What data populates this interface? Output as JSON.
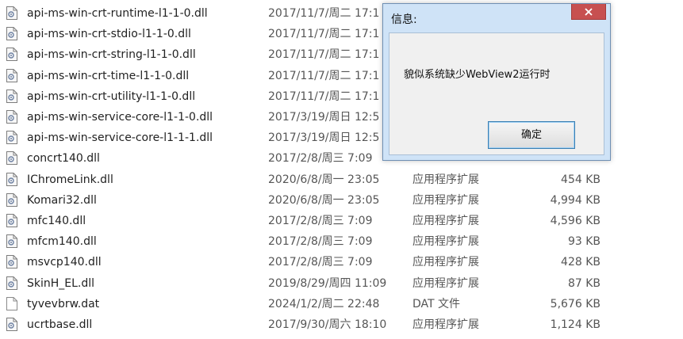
{
  "files": [
    {
      "name": "api-ms-win-crt-runtime-l1-1-0.dll",
      "date": "2017/11/7/周二 17:1",
      "type": "",
      "size": ""
    },
    {
      "name": "api-ms-win-crt-stdio-l1-1-0.dll",
      "date": "2017/11/7/周二 17:1",
      "type": "",
      "size": ""
    },
    {
      "name": "api-ms-win-crt-string-l1-1-0.dll",
      "date": "2017/11/7/周二 17:1",
      "type": "",
      "size": ""
    },
    {
      "name": "api-ms-win-crt-time-l1-1-0.dll",
      "date": "2017/11/7/周二 17:1",
      "type": "",
      "size": ""
    },
    {
      "name": "api-ms-win-crt-utility-l1-1-0.dll",
      "date": "2017/11/7/周二 17:1",
      "type": "",
      "size": ""
    },
    {
      "name": "api-ms-win-service-core-l1-1-0.dll",
      "date": "2017/3/19/周日 12:5",
      "type": "",
      "size": ""
    },
    {
      "name": "api-ms-win-service-core-l1-1-1.dll",
      "date": "2017/3/19/周日 12:5",
      "type": "",
      "size": ""
    },
    {
      "name": "concrt140.dll",
      "date": "2017/2/8/周三 7:09",
      "type": "",
      "size": ""
    },
    {
      "name": "IChromeLink.dll",
      "date": "2020/6/8/周一 23:05",
      "type": "应用程序扩展",
      "size": "454 KB"
    },
    {
      "name": "Komari32.dll",
      "date": "2020/6/8/周一 23:05",
      "type": "应用程序扩展",
      "size": "4,994 KB"
    },
    {
      "name": "mfc140.dll",
      "date": "2017/2/8/周三 7:09",
      "type": "应用程序扩展",
      "size": "4,596 KB"
    },
    {
      "name": "mfcm140.dll",
      "date": "2017/2/8/周三 7:09",
      "type": "应用程序扩展",
      "size": "93 KB"
    },
    {
      "name": "msvcp140.dll",
      "date": "2017/2/8/周三 7:09",
      "type": "应用程序扩展",
      "size": "428 KB"
    },
    {
      "name": "SkinH_EL.dll",
      "date": "2019/8/29/周四 11:09",
      "type": "应用程序扩展",
      "size": "87 KB"
    },
    {
      "name": "tyvevbrw.dat",
      "date": "2024/1/2/周二 22:48",
      "type": "DAT 文件",
      "size": "5,676 KB"
    },
    {
      "name": "ucrtbase.dll",
      "date": "2017/9/30/周六 18:10",
      "type": "应用程序扩展",
      "size": "1,124 KB"
    }
  ],
  "file_icons": [
    "dll-file-icon",
    "dll-file-icon",
    "dll-file-icon",
    "dll-file-icon",
    "dll-file-icon",
    "dll-file-icon",
    "dll-file-icon",
    "dll-file-icon",
    "dll-file-icon",
    "dll-file-icon",
    "dll-file-icon",
    "dll-file-icon",
    "dll-file-icon",
    "dll-file-icon",
    "blank-file-icon",
    "dll-file-icon"
  ],
  "dialog": {
    "title": "信息:",
    "message": "貌似系统缺少WebView2运行时",
    "ok_label": "确定"
  },
  "colors": {
    "dialog_frame": "#cfe3f7",
    "close_button": "#c75050",
    "ok_border": "#3c7fb1"
  }
}
